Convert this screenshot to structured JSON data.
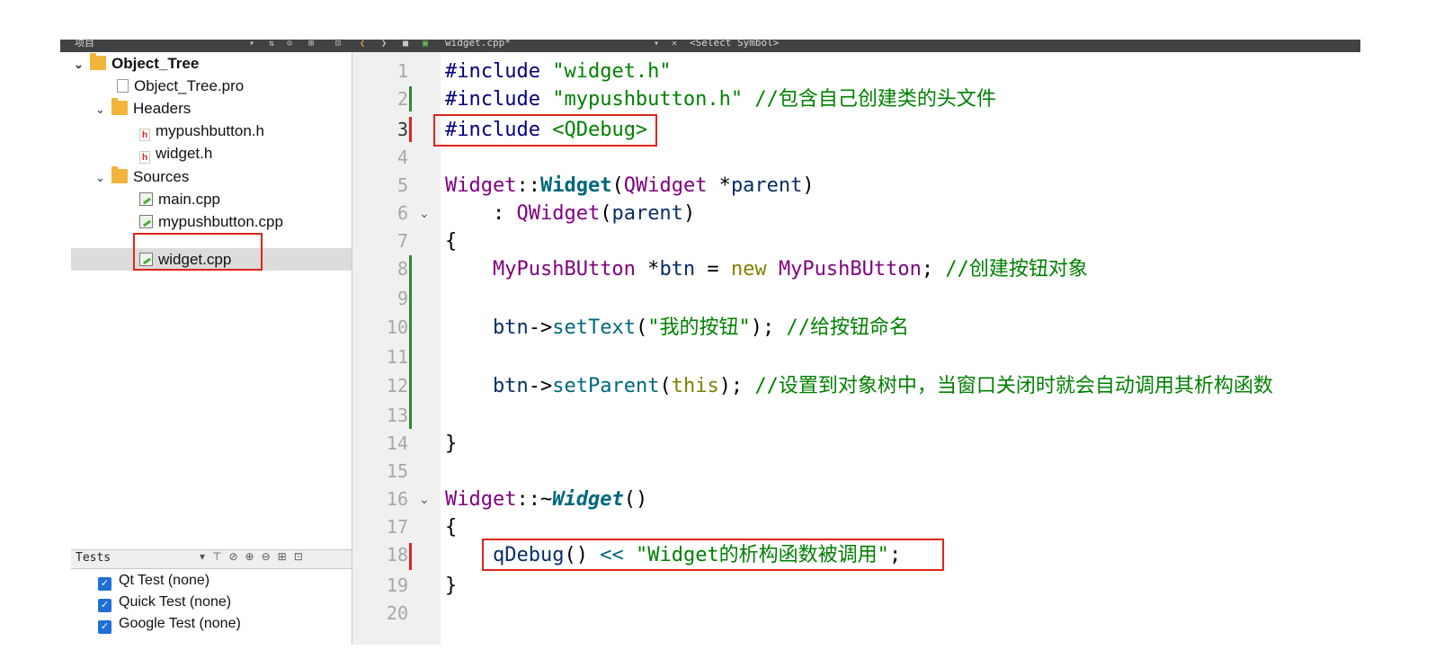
{
  "toolbar": {
    "panel_title": "项目",
    "file_tab": "widget.cpp*",
    "symbol_select": "<Select Symbol>"
  },
  "project_tree": {
    "root": "Object_Tree",
    "pro_file": "Object_Tree.pro",
    "headers_label": "Headers",
    "headers": [
      "mypushbutton.h",
      "widget.h"
    ],
    "sources_label": "Sources",
    "sources": [
      "main.cpp",
      "mypushbutton.cpp",
      "widget.cpp"
    ],
    "selected": "widget.cpp"
  },
  "tests": {
    "title": "Tests",
    "items": [
      "Qt Test (none)",
      "Quick Test (none)",
      "Google Test (none)"
    ]
  },
  "editor": {
    "line_numbers": [
      "1",
      "2",
      "3",
      "4",
      "5",
      "6",
      "7",
      "8",
      "9",
      "10",
      "11",
      "12",
      "13",
      "14",
      "15",
      "16",
      "17",
      "18",
      "19",
      "20"
    ],
    "current_line": 3,
    "highlighted_lines": [
      3,
      18
    ],
    "colors": {
      "modified_marker": "#2e8b2e",
      "current_marker": "#e0251b",
      "highlight_box": "#e0251b"
    }
  },
  "code": {
    "l1_a": "#include ",
    "l1_b": "\"widget.h\"",
    "l2_a": "#include ",
    "l2_b": "\"mypushbutton.h\"",
    "l2_c": " //包含自己创建类的头文件",
    "l3_a": "#include ",
    "l3_b": "<QDebug>",
    "l5_a": "Widget",
    "l5_b": "::",
    "l5_c": "Widget",
    "l5_d": "(",
    "l5_e": "QWidget",
    "l5_f": " *",
    "l5_g": "parent",
    "l5_h": ")",
    "l6_a": "    : ",
    "l6_b": "QWidget",
    "l6_c": "(",
    "l6_d": "parent",
    "l6_e": ")",
    "l7": "{",
    "l8_a": "    ",
    "l8_b": "MyPushBUtton",
    "l8_c": " *",
    "l8_d": "btn",
    "l8_e": " = ",
    "l8_f": "new",
    "l8_g": " ",
    "l8_h": "MyPushBUtton",
    "l8_i": "; ",
    "l8_j": "//创建按钮对象",
    "l10_a": "    ",
    "l10_b": "btn",
    "l10_c": "->",
    "l10_d": "setText",
    "l10_e": "(",
    "l10_f": "\"我的按钮\"",
    "l10_g": "); ",
    "l10_h": "//给按钮命名",
    "l12_a": "    ",
    "l12_b": "btn",
    "l12_c": "->",
    "l12_d": "setParent",
    "l12_e": "(",
    "l12_f": "this",
    "l12_g": "); ",
    "l12_h": "//设置到对象树中，当窗口关闭时就会自动调用其析构函数",
    "l14": "}",
    "l16_a": "Widget",
    "l16_b": "::~",
    "l16_c": "Widget",
    "l16_d": "()",
    "l17": "{",
    "l18_a": "    ",
    "l18_b": "qDebug",
    "l18_c": "() ",
    "l18_d": "<<",
    "l18_e": " ",
    "l18_f": "\"Widget的析构函数被调用\"",
    "l18_g": ";",
    "l19": "}"
  }
}
